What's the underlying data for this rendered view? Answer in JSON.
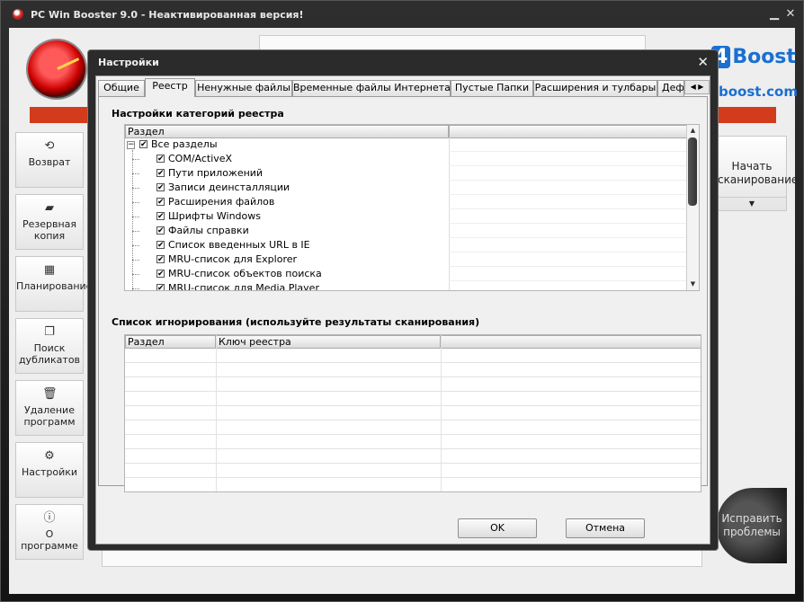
{
  "window": {
    "title": "PC Win Booster 9.0 - Неактивированная версия!",
    "minimize_glyph": "▁",
    "close_glyph": "✕"
  },
  "brand": {
    "badge": "4",
    "name": "Boost",
    "url": "boost.com",
    "color": "#1a6fd1"
  },
  "sidebar": {
    "items": [
      {
        "label": "Возврат",
        "icon": "restore-icon"
      },
      {
        "label": "Резервная копия",
        "icon": "backup-icon"
      },
      {
        "label": "Планирование",
        "icon": "schedule-icon"
      },
      {
        "label": "Поиск дубликатов",
        "icon": "duplicates-icon"
      },
      {
        "label": "Удаление программ",
        "icon": "uninstall-icon"
      },
      {
        "label": "Настройки",
        "icon": "settings-icon"
      },
      {
        "label": "О программе",
        "icon": "info-icon"
      }
    ]
  },
  "right_panel": {
    "scan_label": "Начать сканирование",
    "fix_label": "Исправить проблемы"
  },
  "dialog": {
    "title": "Настройки",
    "tabs": [
      "Общие",
      "Реестр",
      "Ненужные файлы",
      "Временные файлы Интернета",
      "Пустые Папки",
      "Расширения и тулбары",
      "Деф"
    ],
    "active_tab": "Реестр",
    "registry_section": {
      "title": "Настройки категорий реестра",
      "column_header": "Раздел",
      "root": {
        "label": "Все разделы",
        "checked": true,
        "expanded": true
      },
      "items": [
        {
          "label": "COM/ActiveX",
          "checked": true
        },
        {
          "label": "Пути приложений",
          "checked": true
        },
        {
          "label": "Записи деинсталляции",
          "checked": true
        },
        {
          "label": "Расширения файлов",
          "checked": true
        },
        {
          "label": "Шрифты Windows",
          "checked": true
        },
        {
          "label": "Файлы справки",
          "checked": true
        },
        {
          "label": "Список введенных URL в IE",
          "checked": true
        },
        {
          "label": "MRU-список для Explorer",
          "checked": true
        },
        {
          "label": "MRU-список объектов поиска",
          "checked": true
        },
        {
          "label": "MRU-список для Media Player",
          "checked": true
        }
      ]
    },
    "ignore_section": {
      "title": "Список игнорирования (используйте результаты сканирования)",
      "columns": [
        "Раздел",
        "Ключ реестра",
        ""
      ]
    },
    "ok_label": "OK",
    "cancel_label": "Отмена"
  },
  "colors": {
    "accent_red": "#d23c1c",
    "dialog_frame": "#2b2b2b"
  }
}
